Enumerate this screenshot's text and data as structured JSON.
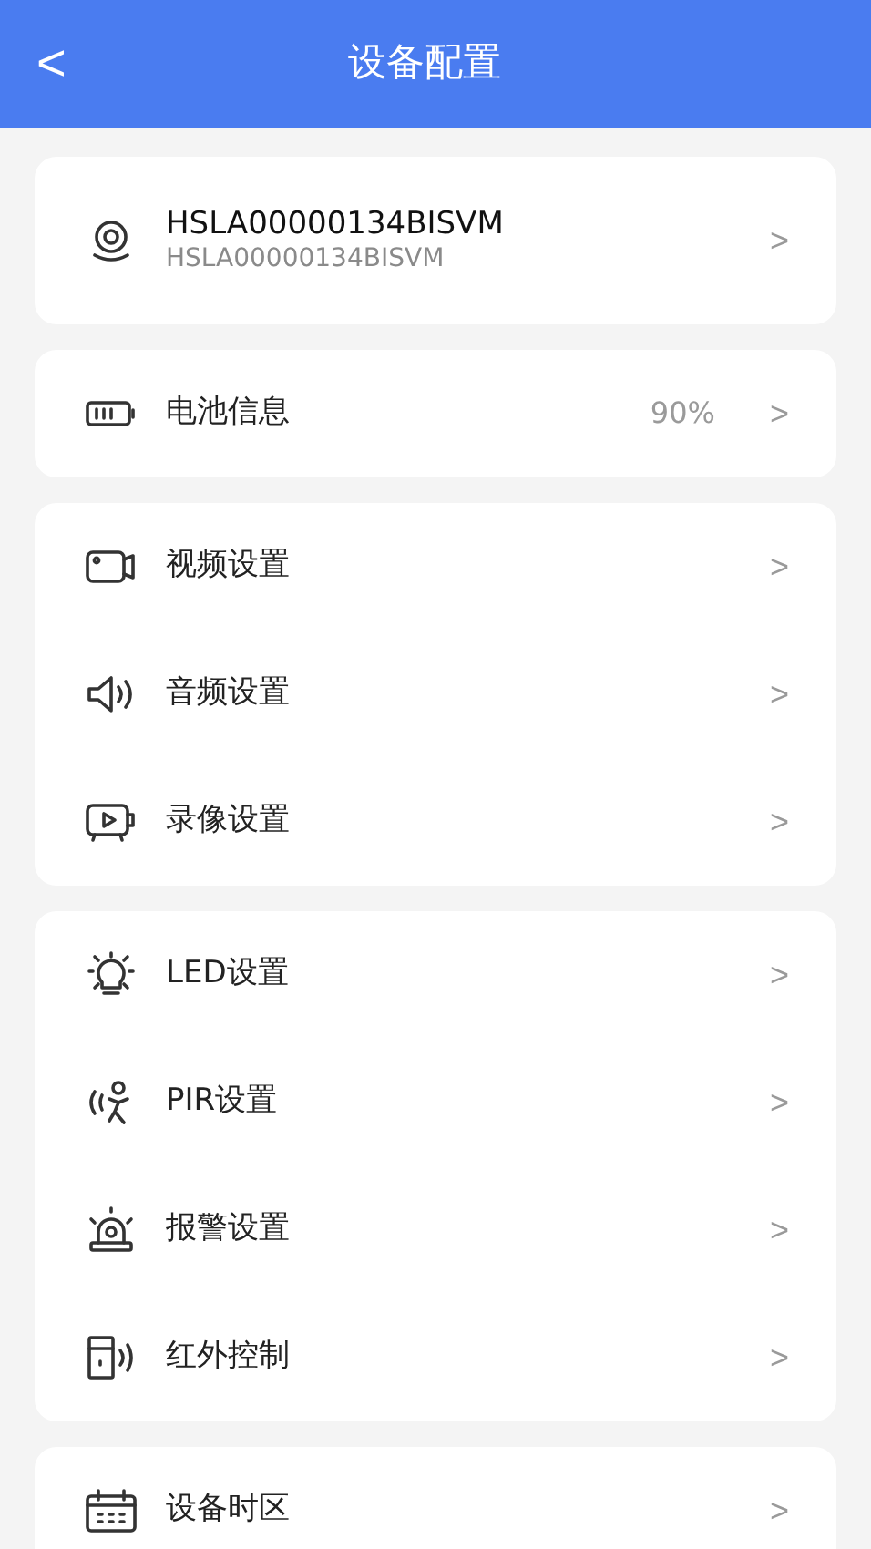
{
  "header": {
    "back": "<",
    "title": "设备配置"
  },
  "device": {
    "name": "HSLA00000134BISVM",
    "subtitle": "HSLA00000134BISVM",
    "chevron": ">"
  },
  "groups": [
    [
      {
        "label": "电池信息",
        "value": "90%",
        "chevron": ">"
      }
    ],
    [
      {
        "label": "视频设置",
        "chevron": ">"
      },
      {
        "label": "音频设置",
        "chevron": ">"
      },
      {
        "label": "录像设置",
        "chevron": ">"
      }
    ],
    [
      {
        "label": "LED设置",
        "chevron": ">"
      },
      {
        "label": "PIR设置",
        "chevron": ">"
      },
      {
        "label": "报警设置",
        "chevron": ">"
      },
      {
        "label": "红外控制",
        "chevron": ">"
      }
    ],
    [
      {
        "label": "设备时区",
        "chevron": ">"
      }
    ]
  ]
}
